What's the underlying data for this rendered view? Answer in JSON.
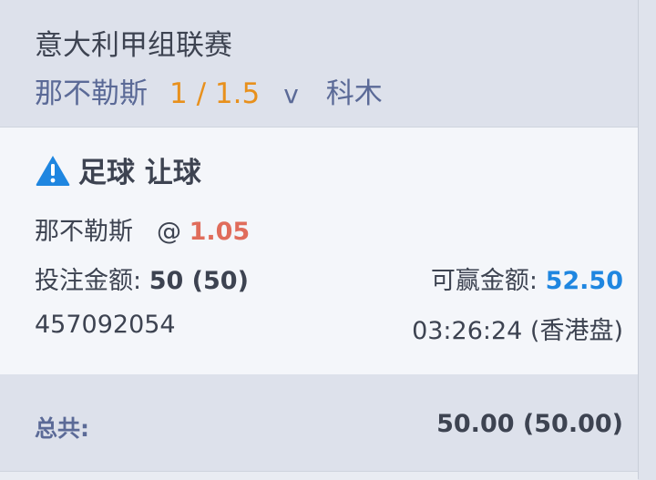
{
  "match": {
    "league": "意大利甲组联赛",
    "home_team": "那不勒斯",
    "handicap": "1 / 1.5",
    "vs": "v",
    "away_team": "科木"
  },
  "bet": {
    "title": "足球 让球",
    "title_icon": "warning-triangle-icon",
    "selection": "那不勒斯",
    "odds_prefix": "@",
    "odds": "1.05",
    "stake_label": "投注金额:",
    "stake_value": "50 (50)",
    "win_label": "可赢金额:",
    "win_value": "52.50",
    "ticket_id": "457092054",
    "time_market": "03:26:24 (香港盘)"
  },
  "total": {
    "label": "总共:",
    "value": "50.00 (50.00)"
  },
  "colors": {
    "handicap": "#e8901c",
    "odds": "#e06c5b",
    "win": "#1f86e0",
    "team": "#5b6a97",
    "warning": "#1f86e0"
  }
}
